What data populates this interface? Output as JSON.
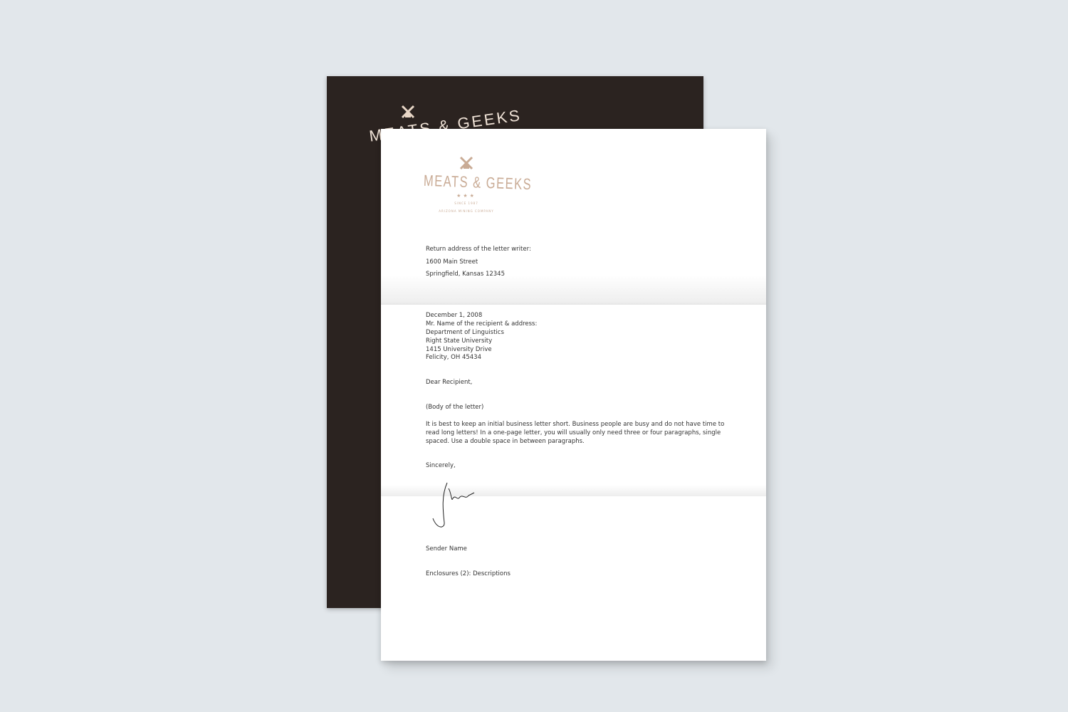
{
  "brand": {
    "name": "MEATS & GEEKS",
    "stars": "★★★",
    "since": "SINCE 1987",
    "tagline": "ARIZONA MINING COMPANY",
    "icon": "windmill-icon",
    "color": "#c9ab95"
  },
  "back_sheet": {
    "title": "MEATS & GEEKS",
    "color": "#2b2320"
  },
  "letter": {
    "return_label": "Return address of the letter writer:",
    "return_street": "1600 Main Street",
    "return_city": "Springfield, Kansas 12345",
    "date": "December 1, 2008",
    "recipient": [
      "Mr. Name of the recipient & address:",
      "Department of Linguistics",
      "Right State University",
      "1415 University Drive",
      "Felicity, OH 45434"
    ],
    "salutation": "Dear Recipient,",
    "body_label": "(Body of the letter)",
    "body": "It is best to keep an initial business letter short. Business people are busy and do not have time to read long letters! In a one-page letter, you will usually only need three or four paragraphs, single spaced. Use a double space in between paragraphs.",
    "closing": "Sincerely,",
    "sender": "Sender Name",
    "enclosures": "Enclosures (2): Descriptions"
  }
}
